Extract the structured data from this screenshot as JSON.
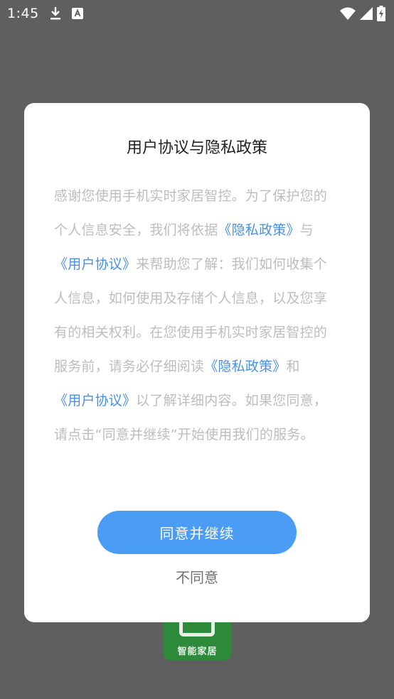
{
  "status_bar": {
    "time": "1:45",
    "icons_left": [
      "download-icon",
      "keyboard-a-icon"
    ],
    "icons_right": [
      "wifi-icon",
      "signal-icon",
      "battery-charging-icon"
    ]
  },
  "background": {
    "logo_text": "智能家居",
    "logo_color": "#2c8a3a"
  },
  "dialog": {
    "title": "用户协议与隐私政策",
    "body": {
      "t1": "感谢您使用手机实时家居智控。为了保护您的个人信息安全，我们将依据",
      "l1": "《隐私政策》",
      "t2": "与",
      "l2": "《用户协议》",
      "t3": "来帮助您了解：我们如何收集个人信息，如何使用及存储个人信息，以及您享有的相关权利。在您使用手机实时家居智控的服务前，请务必仔细阅读",
      "l3": "《隐私政策》",
      "t4": "和",
      "l4": "《用户协议》",
      "t5": "以了解详细内容。如果您同意，请点击“同意并继续”开始使用我们的服务。"
    },
    "agree_label": "同意并继续",
    "disagree_label": "不同意",
    "link_color": "#4a90e2",
    "button_color": "#4a9cf5"
  }
}
